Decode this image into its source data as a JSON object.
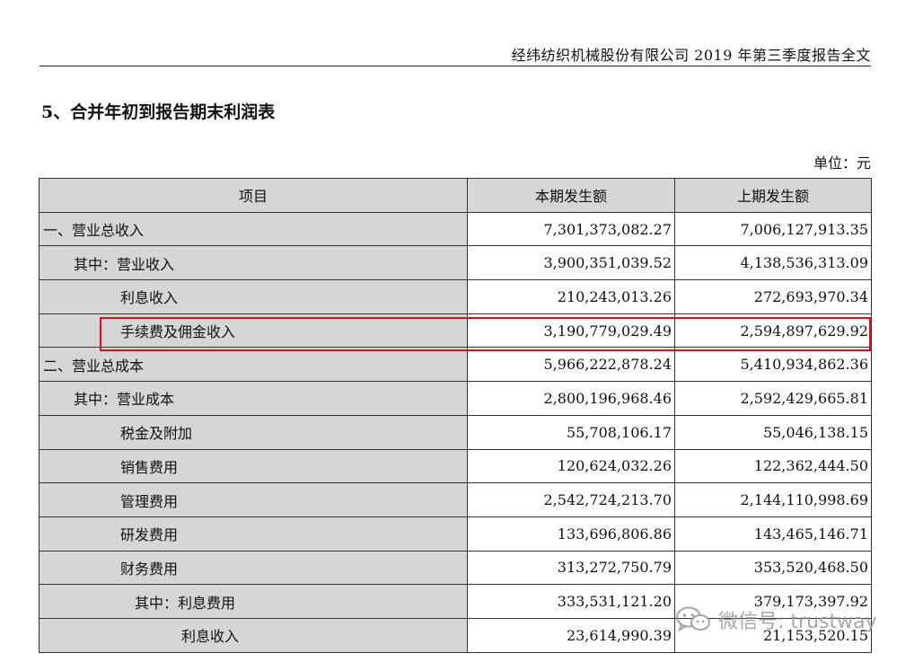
{
  "header": {
    "text": "经纬纺织机械股份有限公司 2019 年第三季度报告全文"
  },
  "section_title": "5、合并年初到报告期末利润表",
  "unit": "单位：元",
  "table": {
    "headers": [
      "项目",
      "本期发生额",
      "上期发生额"
    ],
    "rows": [
      {
        "label": "一、营业总收入",
        "current": "7,301,373,082.27",
        "previous": "7,006,127,913.35"
      },
      {
        "label": "其中：营业收入",
        "current": "3,900,351,039.52",
        "previous": "4,138,536,313.09"
      },
      {
        "label": "利息收入",
        "current": "210,243,013.26",
        "previous": "272,693,970.34"
      },
      {
        "label": "手续费及佣金收入",
        "current": "3,190,779,029.49",
        "previous": "2,594,897,629.92"
      },
      {
        "label": "二、营业总成本",
        "current": "5,966,222,878.24",
        "previous": "5,410,934,862.36"
      },
      {
        "label": "其中：营业成本",
        "current": "2,800,196,968.46",
        "previous": "2,592,429,665.81"
      },
      {
        "label": "税金及附加",
        "current": "55,708,106.17",
        "previous": "55,046,138.15"
      },
      {
        "label": "销售费用",
        "current": "120,624,032.26",
        "previous": "122,362,444.50"
      },
      {
        "label": "管理费用",
        "current": "2,542,724,213.70",
        "previous": "2,144,110,998.69"
      },
      {
        "label": "研发费用",
        "current": "133,696,806.86",
        "previous": "143,465,146.71"
      },
      {
        "label": "财务费用",
        "current": "313,272,750.79",
        "previous": "353,520,468.50"
      },
      {
        "label": "其中：利息费用",
        "current": "333,531,121.20",
        "previous": "379,173,397.92"
      },
      {
        "label": "利息收入",
        "current": "23,614,990.39",
        "previous": "21,153,520.15"
      }
    ]
  },
  "watermark": {
    "text": "微信号: trustway",
    "icon": "wechat-icon"
  },
  "colors": {
    "highlight": "#d9121b",
    "label_cell_bg": "#d6d6d6"
  }
}
